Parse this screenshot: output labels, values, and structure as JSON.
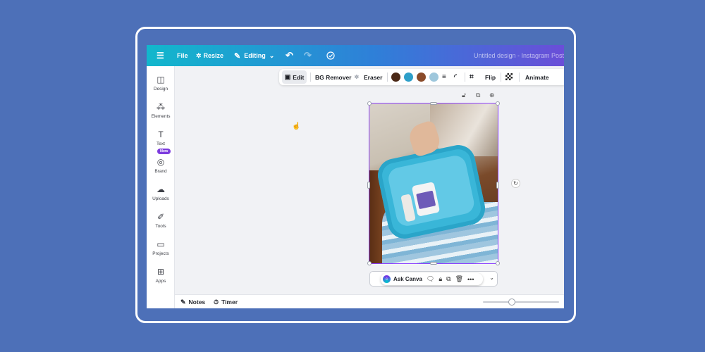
{
  "topbar": {
    "menu_icon": "hamburger-icon",
    "file_label": "File",
    "resize_label": "Resize",
    "editing_label": "Editing",
    "undo_icon": "undo-icon",
    "redo_icon": "redo-icon",
    "cloud_icon": "cloud-check-icon",
    "title": "Untitled design - Instagram Post"
  },
  "sidebar": {
    "items": [
      {
        "label": "Design",
        "icon": "design-icon"
      },
      {
        "label": "Elements",
        "icon": "elements-icon"
      },
      {
        "label": "Text",
        "icon": "text-icon"
      },
      {
        "label": "Brand",
        "icon": "brand-icon",
        "badge": "New"
      },
      {
        "label": "Uploads",
        "icon": "uploads-icon"
      },
      {
        "label": "Tools",
        "icon": "tools-icon"
      },
      {
        "label": "Projects",
        "icon": "projects-icon"
      },
      {
        "label": "Apps",
        "icon": "apps-icon"
      }
    ]
  },
  "context_toolbar": {
    "edit_label": "Edit",
    "bg_remover_label": "BG Remover",
    "eraser_label": "Eraser",
    "swatches": [
      "#4a2816",
      "#2e9fc9",
      "#8a4b2a",
      "#9ec7dc"
    ],
    "flip_label": "Flip",
    "animate_label": "Animate"
  },
  "floating_toolbar": {
    "ask_label": "Ask Canva"
  },
  "bottombar": {
    "notes_label": "Notes",
    "timer_label": "Timer",
    "zoom": 0.33
  },
  "colors": {
    "accent": "#8b3dff",
    "background": "#4d70b8",
    "topbar_start": "#12b7cc",
    "topbar_end": "#6a4ed8"
  }
}
